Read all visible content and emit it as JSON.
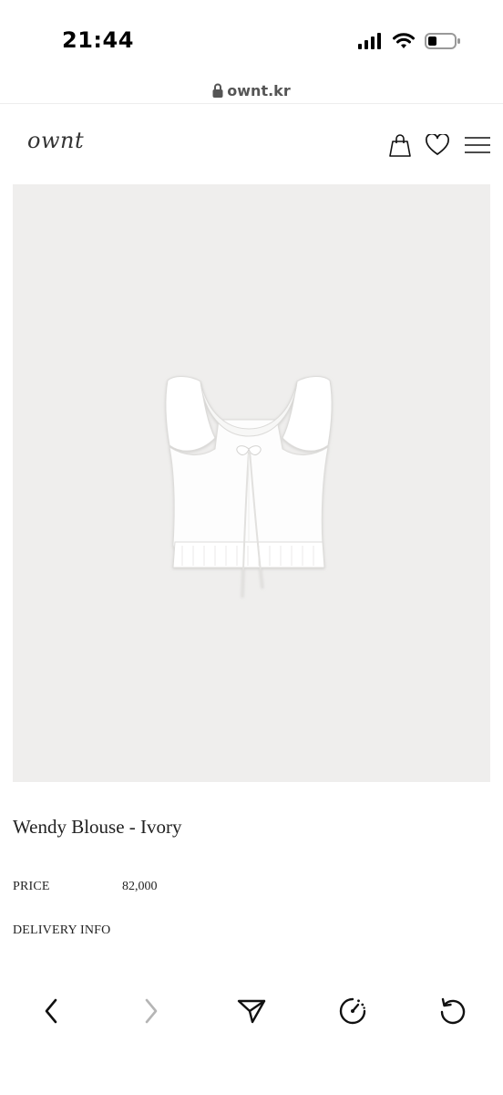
{
  "status_bar": {
    "time": "21:44",
    "icons": [
      "cellular-signal-icon",
      "wifi-icon",
      "battery-icon"
    ]
  },
  "browser": {
    "url": "ownt.kr",
    "toolbar": [
      "back-icon",
      "forward-icon",
      "share-icon",
      "speedometer-icon",
      "refresh-icon"
    ]
  },
  "header": {
    "logo": "ownt",
    "icons": [
      "shopping-bag-icon",
      "heart-icon",
      "menu-icon"
    ]
  },
  "product": {
    "image": "white-ruffle-blouse",
    "title": "Wendy Blouse - Ivory",
    "price_label": "PRICE",
    "price_value": "82,000",
    "delivery_label": "DELIVERY INFO"
  },
  "colors": {
    "image_background": "#efeeed",
    "text": "#222222",
    "background": "#ffffff"
  }
}
